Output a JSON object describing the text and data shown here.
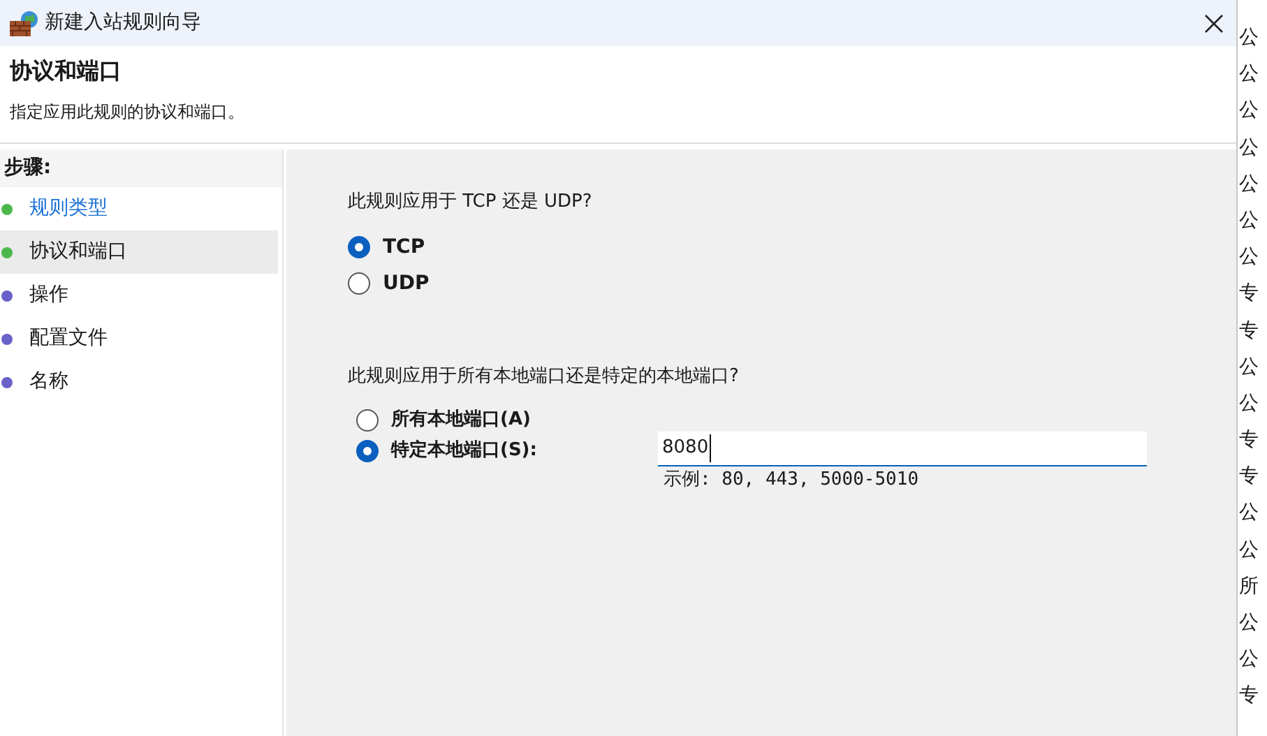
{
  "window": {
    "title": "新建入站规则向导"
  },
  "header": {
    "title": "协议和端口",
    "subtitle": "指定应用此规则的协议和端口。"
  },
  "steps": {
    "heading": "步骤:",
    "items": [
      {
        "label": "规则类型",
        "selected": false,
        "link": true,
        "color": "#4cb84c"
      },
      {
        "label": "协议和端口",
        "selected": true,
        "link": false,
        "color": "#4cb84c"
      },
      {
        "label": "操作",
        "selected": false,
        "link": false,
        "color": "#6a62c8"
      },
      {
        "label": "配置文件",
        "selected": false,
        "link": false,
        "color": "#6a62c8"
      },
      {
        "label": "名称",
        "selected": false,
        "link": false,
        "color": "#6a62c8"
      }
    ]
  },
  "protocol": {
    "question": "此规则应用于 TCP 还是 UDP?",
    "options": [
      {
        "label": "TCP",
        "selected": true
      },
      {
        "label": "UDP",
        "selected": false
      }
    ]
  },
  "ports": {
    "question": "此规则应用于所有本地端口还是特定的本地端口?",
    "options": [
      {
        "label": "所有本地端口(A)",
        "selected": false,
        "has_field": false
      },
      {
        "label": "特定本地端口(S):",
        "selected": true,
        "has_field": true
      }
    ],
    "field": {
      "value": "8080",
      "hint": "示例: 80, 443, 5000-5010"
    }
  },
  "background_list": [
    "公",
    "公",
    "公",
    "公",
    "公",
    "公",
    "公",
    "专",
    "专",
    "公",
    "公",
    "专",
    "专",
    "公",
    "公",
    "所",
    "公",
    "公",
    "专"
  ]
}
